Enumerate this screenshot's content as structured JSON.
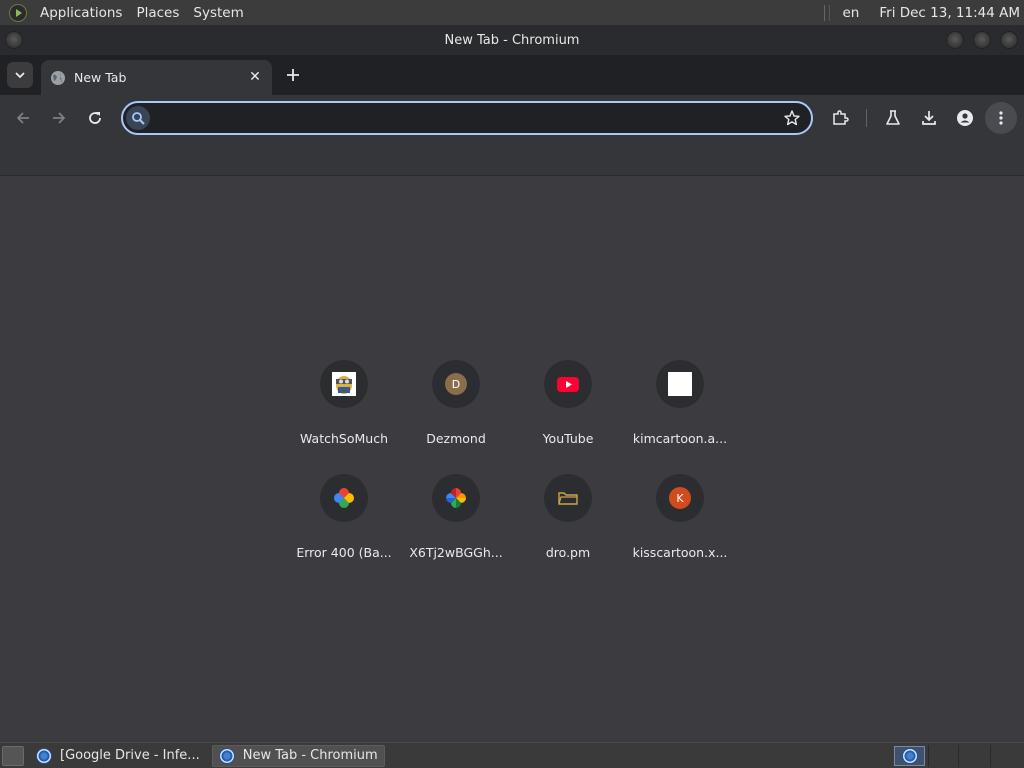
{
  "top_panel": {
    "menus": [
      "Applications",
      "Places",
      "System"
    ],
    "keyboard_layout": "en",
    "clock": "Fri Dec 13, 11:44 AM"
  },
  "window": {
    "title": "New Tab - Chromium"
  },
  "tabs": [
    {
      "title": "New Tab",
      "icon": "globe-icon",
      "active": true
    }
  ],
  "toolbar": {
    "omnibox_value": "",
    "icons": [
      "back-icon",
      "forward-icon",
      "reload-icon",
      "star-icon",
      "extensions-icon",
      "labs-flask-icon",
      "download-icon",
      "profile-icon",
      "menu-dots-icon"
    ]
  },
  "shortcuts": [
    {
      "label": "WatchSoMuch",
      "icon": "watchsomuch-icon"
    },
    {
      "label": "Dezmond",
      "icon": "letter-d-icon",
      "letter": "D",
      "color": "#8a6d4a"
    },
    {
      "label": "YouTube",
      "icon": "youtube-icon"
    },
    {
      "label": "kimcartoon.a...",
      "icon": "white-square-icon"
    },
    {
      "label": "Error 400 (Ba...",
      "icon": "google-photos-icon"
    },
    {
      "label": "X6Tj2wBGGh...",
      "icon": "google-photos-icon"
    },
    {
      "label": "dro.pm",
      "icon": "dro-icon"
    },
    {
      "label": "kisscartoon.x...",
      "icon": "letter-k-icon",
      "letter": "K",
      "color": "#d14b1d"
    }
  ],
  "taskbar": {
    "items": [
      {
        "label": "[Google Drive - Infe...",
        "active": false
      },
      {
        "label": "New Tab - Chromium",
        "active": true
      }
    ]
  },
  "colors": {
    "accent": "#a8c7fa",
    "content_bg": "#3c3c40",
    "tab_strip": "#202124",
    "youtube_red": "#ff0033"
  }
}
